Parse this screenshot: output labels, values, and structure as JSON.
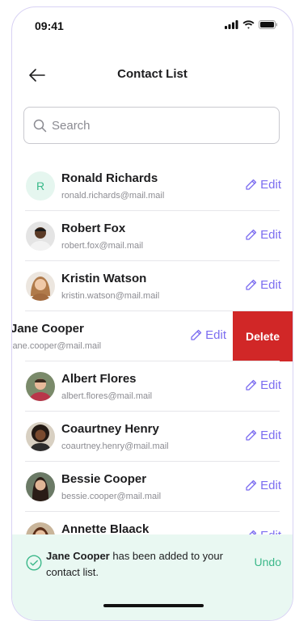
{
  "status": {
    "time": "09:41"
  },
  "header": {
    "title": "Contact List"
  },
  "search": {
    "placeholder": "Search"
  },
  "contacts": [
    {
      "name": "Ronald Richards",
      "email": "ronald.richards@mail.mail",
      "avatar": "initial",
      "initial": "R",
      "edit": "Edit"
    },
    {
      "name": "Robert Fox",
      "email": "robert.fox@mail.mail",
      "avatar": "photo",
      "edit": "Edit"
    },
    {
      "name": "Kristin Watson",
      "email": "kristin.watson@mail.mail",
      "avatar": "photo",
      "edit": "Edit"
    },
    {
      "name": "Jane Cooper",
      "email": "jane.cooper@mail.mail",
      "avatar": "none",
      "edit": "Edit",
      "delete": "Delete"
    },
    {
      "name": "Albert Flores",
      "email": "albert.flores@mail.mail",
      "avatar": "photo",
      "edit": "Edit"
    },
    {
      "name": "Coaurtney Henry",
      "email": "coaurtney.henry@mail.mail",
      "avatar": "photo",
      "edit": "Edit"
    },
    {
      "name": "Bessie Cooper",
      "email": "bessie.cooper@mail.mail",
      "avatar": "photo",
      "edit": "Edit"
    },
    {
      "name": "Annette Blaack",
      "email": "",
      "avatar": "photo",
      "edit": "Edit"
    }
  ],
  "toast": {
    "name": "Jane Cooper",
    "message": " has been added to your contact list.",
    "undo": "Undo"
  },
  "colors": {
    "accent": "#7b6cf0",
    "success": "#3cb88a",
    "danger": "#d12727"
  }
}
